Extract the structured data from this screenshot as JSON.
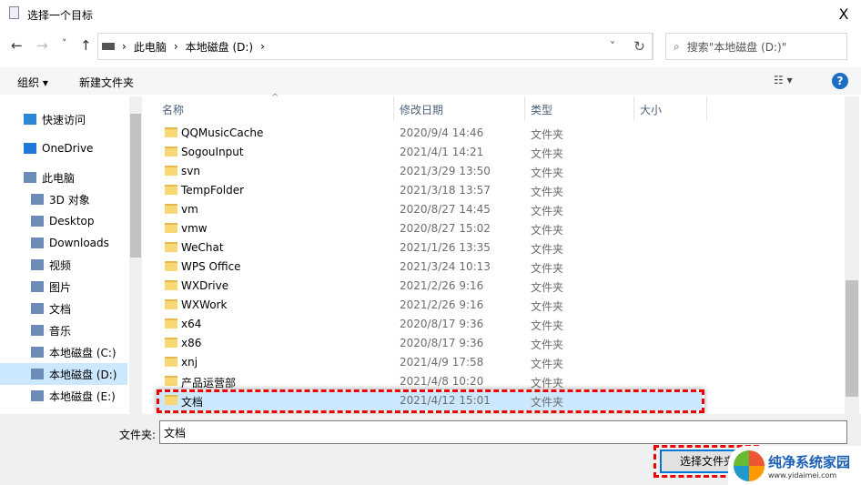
{
  "window": {
    "title": "选择一个目标",
    "close": "X"
  },
  "nav": {
    "back": "←",
    "forward": "→",
    "recent": "˅",
    "up": "↑"
  },
  "address": {
    "crumbs": [
      "此电脑",
      "本地磁盘 (D:)"
    ],
    "refresh": "↻"
  },
  "search": {
    "placeholder": "搜索\"本地磁盘 (D:)\""
  },
  "toolbar": {
    "organize": "组织 ▾",
    "new_folder": "新建文件夹",
    "view": "☷ ▾",
    "help": "?"
  },
  "sidebar": {
    "items": [
      {
        "label": "快速访问",
        "icon": "star-icon"
      },
      {
        "label": "OneDrive",
        "icon": "cloud-icon"
      },
      {
        "label": "此电脑",
        "icon": "computer-icon"
      },
      {
        "label": "3D 对象",
        "icon": "cube-icon"
      },
      {
        "label": "Desktop",
        "icon": "desktop-icon"
      },
      {
        "label": "Downloads",
        "icon": "download-icon"
      },
      {
        "label": "视频",
        "icon": "video-icon"
      },
      {
        "label": "图片",
        "icon": "picture-icon"
      },
      {
        "label": "文档",
        "icon": "document-icon"
      },
      {
        "label": "音乐",
        "icon": "music-icon"
      },
      {
        "label": "本地磁盘 (C:)",
        "icon": "drive-icon"
      },
      {
        "label": "本地磁盘 (D:)",
        "icon": "drive-icon",
        "selected": true
      },
      {
        "label": "本地磁盘 (E:)",
        "icon": "drive-icon"
      }
    ]
  },
  "columns": [
    "名称",
    "修改日期",
    "类型",
    "大小"
  ],
  "files": [
    [
      "QQMusicCache",
      "2020/9/4 14:46",
      "文件夹"
    ],
    [
      "SogouInput",
      "2021/4/1 14:21",
      "文件夹"
    ],
    [
      "svn",
      "2021/3/29 13:50",
      "文件夹"
    ],
    [
      "TempFolder",
      "2021/3/18 13:57",
      "文件夹"
    ],
    [
      "vm",
      "2020/8/27 14:45",
      "文件夹"
    ],
    [
      "vmw",
      "2020/8/27 15:02",
      "文件夹"
    ],
    [
      "WeChat",
      "2021/1/26 13:35",
      "文件夹"
    ],
    [
      "WPS Office",
      "2021/3/24 10:13",
      "文件夹"
    ],
    [
      "WXDrive",
      "2021/2/26 9:16",
      "文件夹"
    ],
    [
      "WXWork",
      "2021/2/26 9:16",
      "文件夹"
    ],
    [
      "x64",
      "2020/8/17 9:36",
      "文件夹"
    ],
    [
      "x86",
      "2020/8/17 9:36",
      "文件夹"
    ],
    [
      "xnj",
      "2021/4/9 17:58",
      "文件夹"
    ],
    [
      "产品运营部",
      "2021/4/8 10:20",
      "文件夹"
    ],
    [
      "文档",
      "2021/4/12 15:01",
      "文件夹"
    ]
  ],
  "selected_file": "文档",
  "footer": {
    "folder_label": "文件夹:",
    "folder_value": "文档",
    "select_button": "选择文件夹"
  },
  "watermark": {
    "name": "纯净系统家园",
    "url": "www.yidaimei.com"
  },
  "colors": {
    "selection": "#cce8ff",
    "highlight": "#ee0000",
    "accent": "#0078d7"
  }
}
